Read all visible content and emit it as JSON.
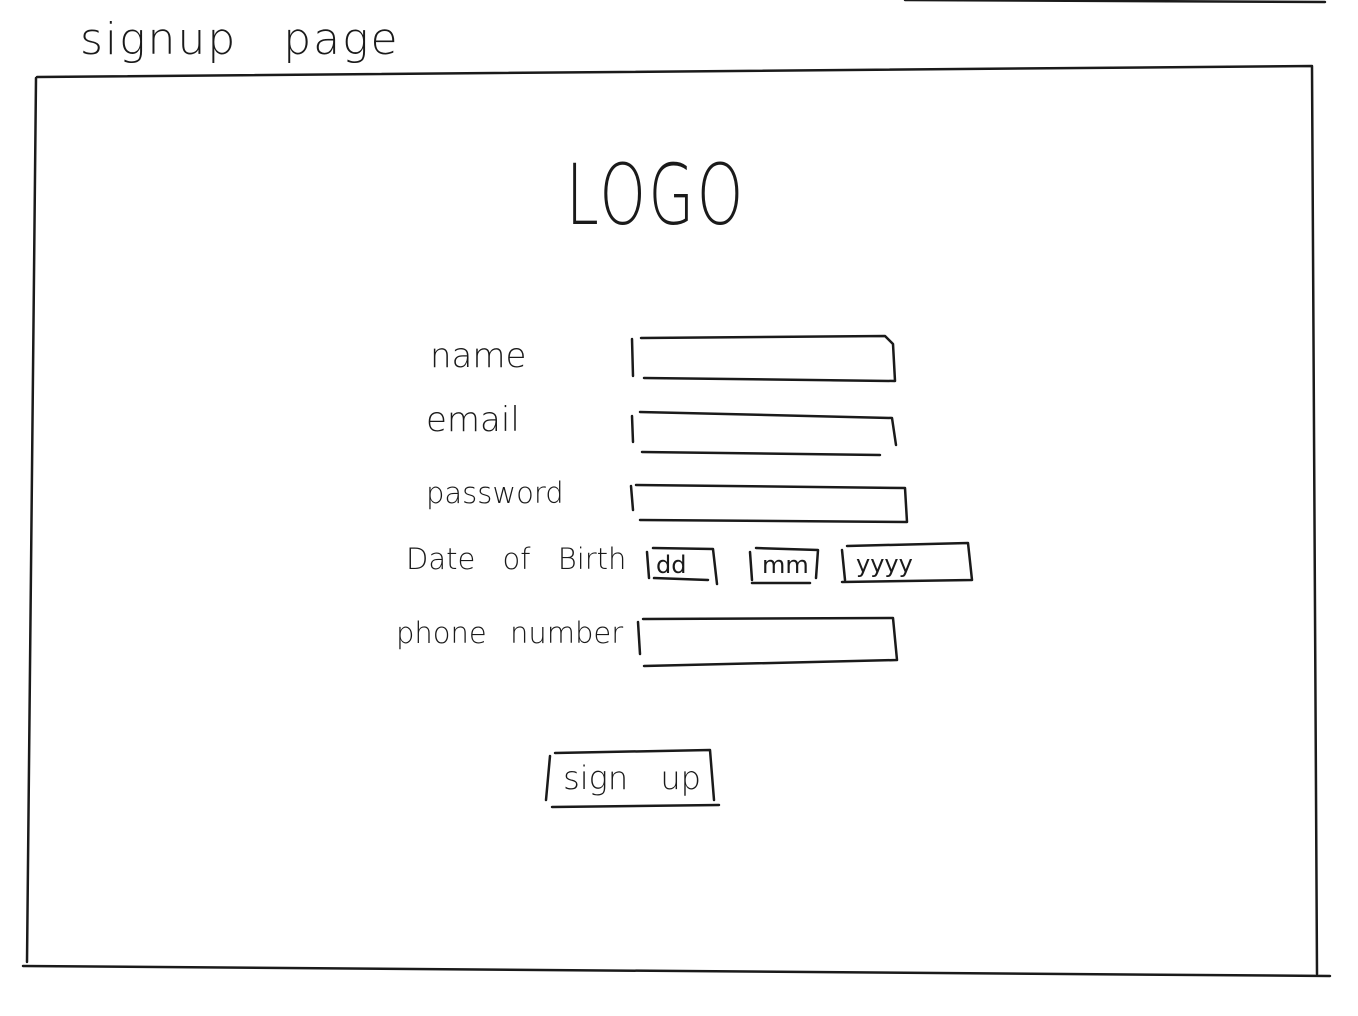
{
  "header": {
    "title": "signup page"
  },
  "brand": {
    "logo_text": "LOGO"
  },
  "form": {
    "name": {
      "label": "name",
      "value": ""
    },
    "email": {
      "label": "email",
      "value": ""
    },
    "password": {
      "label": "password",
      "value": ""
    },
    "date_of_birth": {
      "label": "Date of Birth",
      "day_placeholder": "dd",
      "month_placeholder": "mm",
      "year_placeholder": "yyyy"
    },
    "phone_number": {
      "label": "phone number",
      "value": ""
    },
    "submit_label": "sign up"
  },
  "colors": {
    "ink": "#1a1a1a",
    "paper": "#ffffff"
  }
}
